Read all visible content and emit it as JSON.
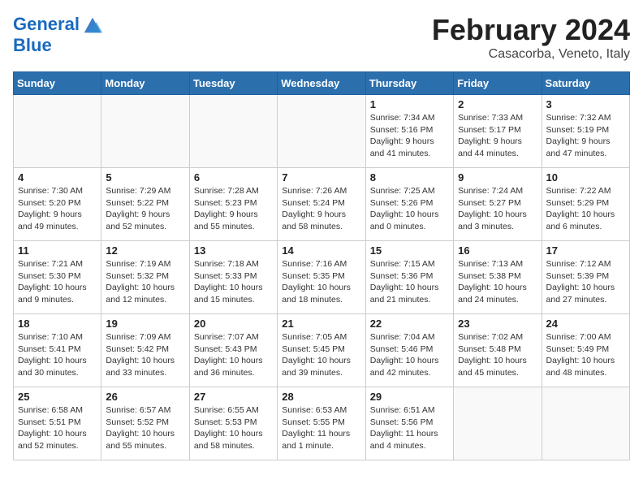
{
  "header": {
    "logo_line1": "General",
    "logo_line2": "Blue",
    "month_title": "February 2024",
    "location": "Casacorba, Veneto, Italy"
  },
  "days_of_week": [
    "Sunday",
    "Monday",
    "Tuesday",
    "Wednesday",
    "Thursday",
    "Friday",
    "Saturday"
  ],
  "weeks": [
    [
      {
        "day": "",
        "info": ""
      },
      {
        "day": "",
        "info": ""
      },
      {
        "day": "",
        "info": ""
      },
      {
        "day": "",
        "info": ""
      },
      {
        "day": "1",
        "info": "Sunrise: 7:34 AM\nSunset: 5:16 PM\nDaylight: 9 hours\nand 41 minutes."
      },
      {
        "day": "2",
        "info": "Sunrise: 7:33 AM\nSunset: 5:17 PM\nDaylight: 9 hours\nand 44 minutes."
      },
      {
        "day": "3",
        "info": "Sunrise: 7:32 AM\nSunset: 5:19 PM\nDaylight: 9 hours\nand 47 minutes."
      }
    ],
    [
      {
        "day": "4",
        "info": "Sunrise: 7:30 AM\nSunset: 5:20 PM\nDaylight: 9 hours\nand 49 minutes."
      },
      {
        "day": "5",
        "info": "Sunrise: 7:29 AM\nSunset: 5:22 PM\nDaylight: 9 hours\nand 52 minutes."
      },
      {
        "day": "6",
        "info": "Sunrise: 7:28 AM\nSunset: 5:23 PM\nDaylight: 9 hours\nand 55 minutes."
      },
      {
        "day": "7",
        "info": "Sunrise: 7:26 AM\nSunset: 5:24 PM\nDaylight: 9 hours\nand 58 minutes."
      },
      {
        "day": "8",
        "info": "Sunrise: 7:25 AM\nSunset: 5:26 PM\nDaylight: 10 hours\nand 0 minutes."
      },
      {
        "day": "9",
        "info": "Sunrise: 7:24 AM\nSunset: 5:27 PM\nDaylight: 10 hours\nand 3 minutes."
      },
      {
        "day": "10",
        "info": "Sunrise: 7:22 AM\nSunset: 5:29 PM\nDaylight: 10 hours\nand 6 minutes."
      }
    ],
    [
      {
        "day": "11",
        "info": "Sunrise: 7:21 AM\nSunset: 5:30 PM\nDaylight: 10 hours\nand 9 minutes."
      },
      {
        "day": "12",
        "info": "Sunrise: 7:19 AM\nSunset: 5:32 PM\nDaylight: 10 hours\nand 12 minutes."
      },
      {
        "day": "13",
        "info": "Sunrise: 7:18 AM\nSunset: 5:33 PM\nDaylight: 10 hours\nand 15 minutes."
      },
      {
        "day": "14",
        "info": "Sunrise: 7:16 AM\nSunset: 5:35 PM\nDaylight: 10 hours\nand 18 minutes."
      },
      {
        "day": "15",
        "info": "Sunrise: 7:15 AM\nSunset: 5:36 PM\nDaylight: 10 hours\nand 21 minutes."
      },
      {
        "day": "16",
        "info": "Sunrise: 7:13 AM\nSunset: 5:38 PM\nDaylight: 10 hours\nand 24 minutes."
      },
      {
        "day": "17",
        "info": "Sunrise: 7:12 AM\nSunset: 5:39 PM\nDaylight: 10 hours\nand 27 minutes."
      }
    ],
    [
      {
        "day": "18",
        "info": "Sunrise: 7:10 AM\nSunset: 5:41 PM\nDaylight: 10 hours\nand 30 minutes."
      },
      {
        "day": "19",
        "info": "Sunrise: 7:09 AM\nSunset: 5:42 PM\nDaylight: 10 hours\nand 33 minutes."
      },
      {
        "day": "20",
        "info": "Sunrise: 7:07 AM\nSunset: 5:43 PM\nDaylight: 10 hours\nand 36 minutes."
      },
      {
        "day": "21",
        "info": "Sunrise: 7:05 AM\nSunset: 5:45 PM\nDaylight: 10 hours\nand 39 minutes."
      },
      {
        "day": "22",
        "info": "Sunrise: 7:04 AM\nSunset: 5:46 PM\nDaylight: 10 hours\nand 42 minutes."
      },
      {
        "day": "23",
        "info": "Sunrise: 7:02 AM\nSunset: 5:48 PM\nDaylight: 10 hours\nand 45 minutes."
      },
      {
        "day": "24",
        "info": "Sunrise: 7:00 AM\nSunset: 5:49 PM\nDaylight: 10 hours\nand 48 minutes."
      }
    ],
    [
      {
        "day": "25",
        "info": "Sunrise: 6:58 AM\nSunset: 5:51 PM\nDaylight: 10 hours\nand 52 minutes."
      },
      {
        "day": "26",
        "info": "Sunrise: 6:57 AM\nSunset: 5:52 PM\nDaylight: 10 hours\nand 55 minutes."
      },
      {
        "day": "27",
        "info": "Sunrise: 6:55 AM\nSunset: 5:53 PM\nDaylight: 10 hours\nand 58 minutes."
      },
      {
        "day": "28",
        "info": "Sunrise: 6:53 AM\nSunset: 5:55 PM\nDaylight: 11 hours\nand 1 minute."
      },
      {
        "day": "29",
        "info": "Sunrise: 6:51 AM\nSunset: 5:56 PM\nDaylight: 11 hours\nand 4 minutes."
      },
      {
        "day": "",
        "info": ""
      },
      {
        "day": "",
        "info": ""
      }
    ]
  ]
}
